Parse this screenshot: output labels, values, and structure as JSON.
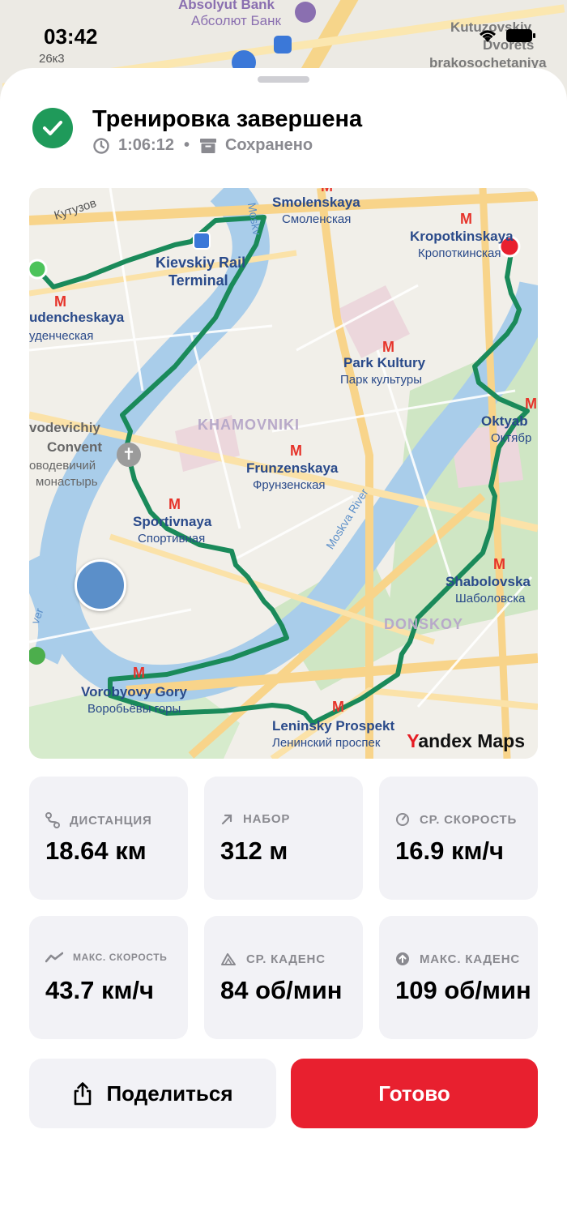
{
  "status_bar": {
    "time": "03:42",
    "sub": "26к3"
  },
  "background_map": {
    "labels": [
      "Absolyut Bank",
      "Абсолют Банк",
      "Kutuzovskiy",
      "Dvorets",
      "brakosochetaniya"
    ]
  },
  "header": {
    "title": "Тренировка завершена",
    "duration": "1:06:12",
    "separator": "•",
    "saved": "Сохранено"
  },
  "map": {
    "brand_y": "Y",
    "brand_rest": "andex Maps",
    "labels": {
      "smolenskaya": "Smolenskaya",
      "smolenskaya_ru": "Смоленская",
      "kropotkinskaya": "Kropotkinskaya",
      "kropotkinskaya_ru": "Кропоткинская",
      "kievskiy1": "Kievskiy Rail",
      "kievskiy2": "Terminal",
      "studencheskaya": "udencheskaya",
      "studencheskaya_ru": "уденческая",
      "kutuzovsky": "Кутузов",
      "park_kultury": "Park Kultury",
      "park_kultury_ru": "Парк культуры",
      "khamovniki": "KHAMOVNIKI",
      "novodevichiy1": "vodevichiy",
      "novodevichiy2": "Convent",
      "novodevichiy3": "оводевичий",
      "novodevichiy4": "монастырь",
      "frunzenskaya": "Frunzenskaya",
      "frunzenskaya_ru": "Фрунзенская",
      "oktyab": "Oktyab",
      "oktyab_ru": "Октябр",
      "sportivnaya": "Sportivnaya",
      "sportivnaya_ru": "Спортивная",
      "moskva_river": "Moskva River",
      "moskva_short": "Moskv",
      "shabolovskaya": "Shabolovska",
      "shabolovskaya_ru": "Шаболовска",
      "donskoy": "DONSKOY",
      "vorobyovy": "Vorobyovy Gory",
      "vorobyovy_ru": "Воробьёвы горы",
      "leninsky": "Leninsky Prospekt",
      "leninsky_ru": "Ленинский проспек",
      "river_left": "ver"
    }
  },
  "stats": [
    {
      "label": "ДИСТАНЦИЯ",
      "value": "18.64 км",
      "icon": "route-icon"
    },
    {
      "label": "НАБОР",
      "value": "312 м",
      "icon": "arrow-up-right-icon"
    },
    {
      "label": "СР. СКОРОСТЬ",
      "value": "16.9 км/ч",
      "icon": "gauge-icon"
    },
    {
      "label": "МАКС. СКОРОСТЬ",
      "value": "43.7 км/ч",
      "icon": "trend-icon"
    },
    {
      "label": "СР. КАДЕНС",
      "value": "84 об/мин",
      "icon": "cadence-icon"
    },
    {
      "label": "МАКС. КАДЕНС",
      "value": "109 об/мин",
      "icon": "arrow-up-circle-icon"
    }
  ],
  "buttons": {
    "share": "Поделиться",
    "done": "Готово"
  },
  "colors": {
    "accent_green": "#1f9a5a",
    "route": "#1a8a5a",
    "done_red": "#e8202f"
  }
}
